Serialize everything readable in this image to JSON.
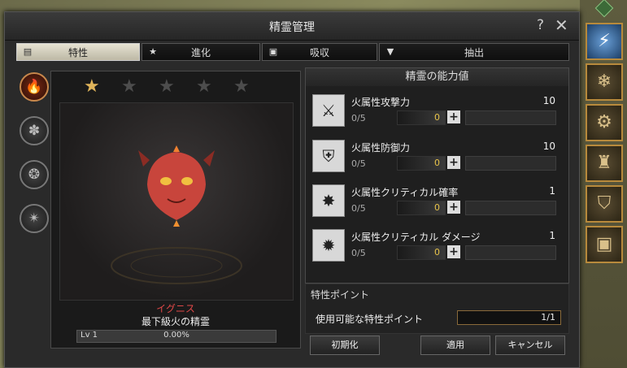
{
  "window": {
    "title": "精霊管理",
    "help": "?",
    "close": "✕"
  },
  "tabs": [
    {
      "label": "特性",
      "icon": "▤"
    },
    {
      "label": "進化",
      "icon": "★"
    },
    {
      "label": "吸収",
      "icon": "▣"
    },
    {
      "label": "抽出",
      "icon": "▼"
    }
  ],
  "elements": [
    {
      "name": "fire-element",
      "glyph": "🔥"
    },
    {
      "name": "water-element",
      "glyph": "✽"
    },
    {
      "name": "wind-element",
      "glyph": "❂"
    },
    {
      "name": "earth-element",
      "glyph": "✴"
    }
  ],
  "spirit": {
    "stars_total": 5,
    "stars_filled": 1,
    "name": "イグニス",
    "description": "最下級火の精霊",
    "level_label": "Lv 1",
    "exp_percent": "0.00%"
  },
  "panel": {
    "title": "精霊の能力値",
    "stats": [
      {
        "name": "火属性攻撃力",
        "value": "10",
        "points": "0/5",
        "add": "0",
        "icon": "⚔"
      },
      {
        "name": "火属性防御力",
        "value": "10",
        "points": "0/5",
        "add": "0",
        "icon": "⛨"
      },
      {
        "name": "火属性クリティカル確率",
        "value": "1",
        "points": "0/5",
        "add": "0",
        "icon": "✸"
      },
      {
        "name": "火属性クリティカル ダメージ",
        "value": "1",
        "points": "0/5",
        "add": "0",
        "icon": "✹"
      }
    ]
  },
  "trait": {
    "header": "特性ポイント",
    "label": "使用可能な特性ポイント",
    "value": "1/1"
  },
  "buttons": {
    "reset": "初期化",
    "apply": "適用",
    "cancel": "キャンセル"
  },
  "sidebar": [
    "⚡",
    "❄",
    "⚙",
    "♜",
    "⛉",
    "▣"
  ]
}
